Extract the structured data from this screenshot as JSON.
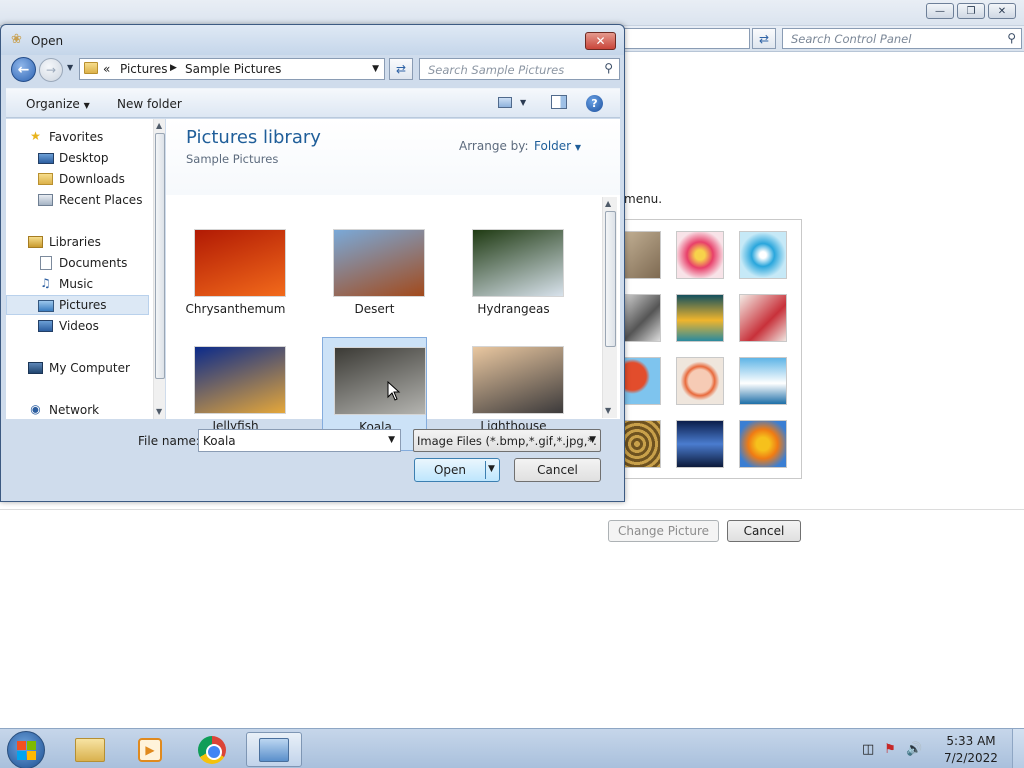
{
  "background": {
    "search_placeholder": "Search Control Panel",
    "menu_text": "menu.",
    "change_picture_label": "Change Picture",
    "cancel_label": "Cancel"
  },
  "dialog": {
    "title": "Open",
    "address": {
      "chevron": "«",
      "crumbs": [
        "Pictures",
        "Sample Pictures"
      ]
    },
    "search_placeholder": "Search Sample Pictures",
    "toolbar": {
      "organize": "Organize",
      "new_folder": "New folder"
    },
    "nav": {
      "favorites": "Favorites",
      "desktop": "Desktop",
      "downloads": "Downloads",
      "recent_places": "Recent Places",
      "libraries": "Libraries",
      "documents": "Documents",
      "music": "Music",
      "pictures": "Pictures",
      "videos": "Videos",
      "my_computer": "My Computer",
      "network": "Network"
    },
    "content": {
      "library_title": "Pictures library",
      "library_subtitle": "Sample Pictures",
      "arrange_label": "Arrange by:",
      "arrange_value": "Folder",
      "items": [
        {
          "name": "Chrysanthemum",
          "colors": [
            "#b11a04",
            "#f26a1b"
          ]
        },
        {
          "name": "Desert",
          "colors": [
            "#7aa9d8",
            "#a24a1c"
          ]
        },
        {
          "name": "Hydrangeas",
          "colors": [
            "#1f3a12",
            "#d8e2ec"
          ]
        },
        {
          "name": "Jellyfish",
          "colors": [
            "#0b2a8a",
            "#e5a73a"
          ]
        },
        {
          "name": "Koala",
          "colors": [
            "#3b3a35",
            "#b4b4b0"
          ]
        },
        {
          "name": "Lighthouse",
          "colors": [
            "#e9c7a0",
            "#3c3a3b"
          ]
        }
      ],
      "selected_item": "Koala"
    },
    "file_name_label": "File name:",
    "file_name_value": "Koala",
    "file_type": "Image Files (*.bmp,*.gif,*.jpg,*.",
    "open_label": "Open",
    "cancel_label": "Cancel"
  },
  "taskbar": {
    "time": "5:33 AM",
    "date": "7/2/2022"
  }
}
